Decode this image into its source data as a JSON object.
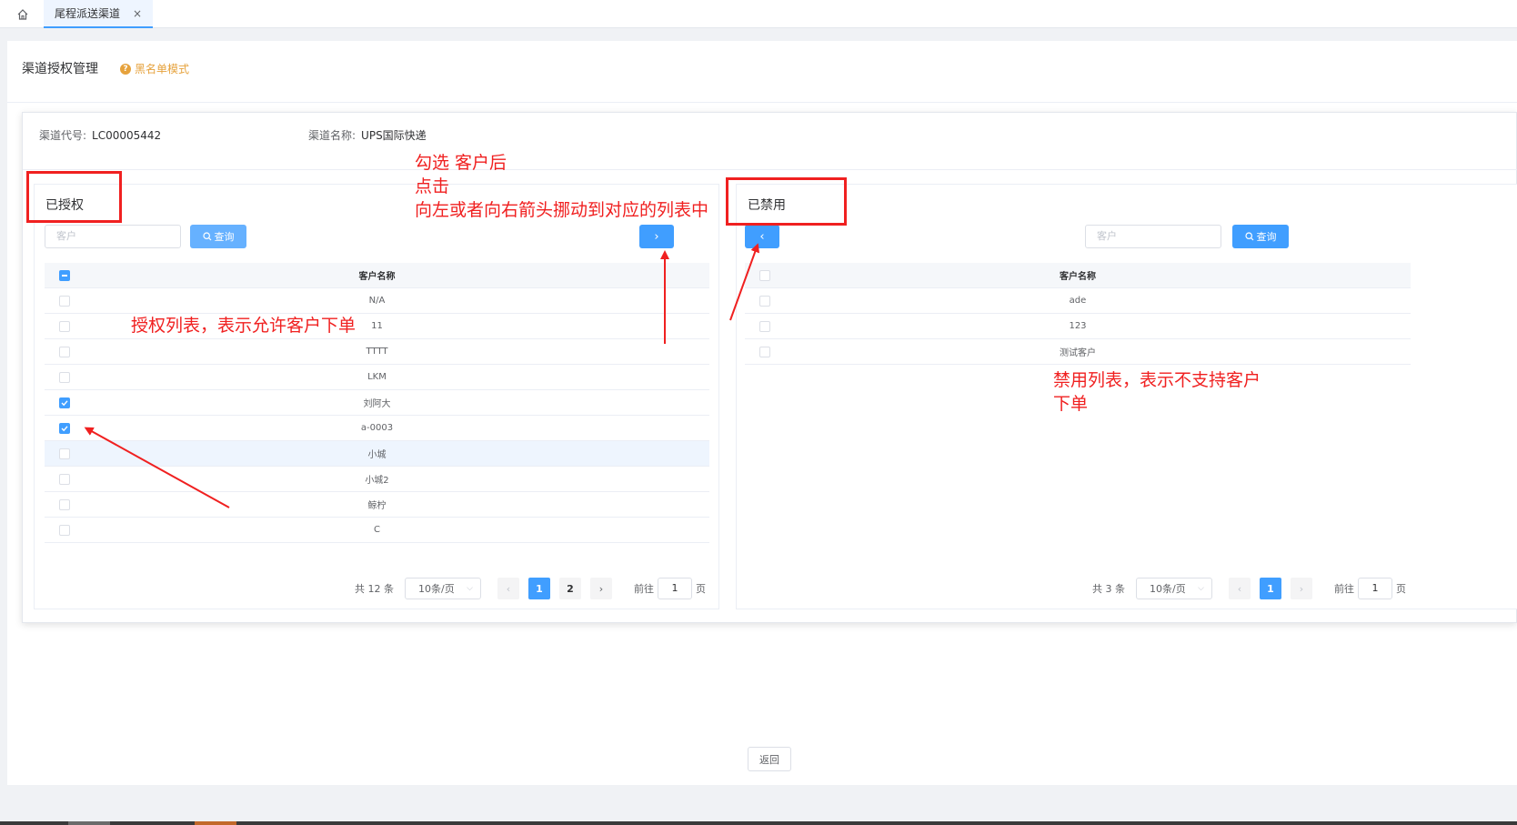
{
  "tabs": {
    "home_label": "home",
    "active_tab": "尾程派送渠道",
    "close": "×"
  },
  "header": {
    "title": "渠道授权管理",
    "mode": "黑名单模式"
  },
  "channel": {
    "code_label": "渠道代号:",
    "code_value": "LC00005442",
    "name_label": "渠道名称:",
    "name_value": "UPS国际快递"
  },
  "left_panel": {
    "title": "已授权",
    "search_placeholder": "客户",
    "query_label": "查询",
    "move_arrow": "›",
    "column": "客户名称",
    "rows": [
      {
        "name": "N/A",
        "checked": false
      },
      {
        "name": "11",
        "checked": false
      },
      {
        "name": "TTTT",
        "checked": false
      },
      {
        "name": "LKM",
        "checked": false
      },
      {
        "name": "刘阿大",
        "checked": true
      },
      {
        "name": "a-0003",
        "checked": true
      },
      {
        "name": "小城",
        "checked": false
      },
      {
        "name": "小城2",
        "checked": false
      },
      {
        "name": "鲸柠",
        "checked": false
      },
      {
        "name": "C",
        "checked": false
      }
    ],
    "pager": {
      "total": "共 12 条",
      "page_size": "10条/页",
      "pages": [
        "1",
        "2"
      ],
      "current": "1",
      "goto_label": "前往",
      "goto_value": "1",
      "page_suffix": "页"
    }
  },
  "right_panel": {
    "title": "已禁用",
    "search_placeholder": "客户",
    "query_label": "查询",
    "move_arrow": "‹",
    "column": "客户名称",
    "rows": [
      {
        "name": "ade",
        "checked": false
      },
      {
        "name": "123",
        "checked": false
      },
      {
        "name": "测试客户",
        "checked": false
      }
    ],
    "pager": {
      "total": "共 3 条",
      "page_size": "10条/页",
      "pages": [
        "1"
      ],
      "current": "1",
      "goto_label": "前往",
      "goto_value": "1",
      "page_suffix": "页"
    }
  },
  "footer": {
    "back_label": "返回"
  },
  "annotations": {
    "instruction_line1": "勾选  客户后",
    "instruction_line2": "点击",
    "instruction_line3": "向左或者向右箭头挪动到对应的列表中",
    "left_note": "授权列表，表示允许客户下单",
    "right_note_line1": "禁用列表，表示不支持客户",
    "right_note_line2": "下单"
  },
  "colors": {
    "primary": "#409eff",
    "warning": "#e6a23c",
    "annotation": "#f02020"
  }
}
